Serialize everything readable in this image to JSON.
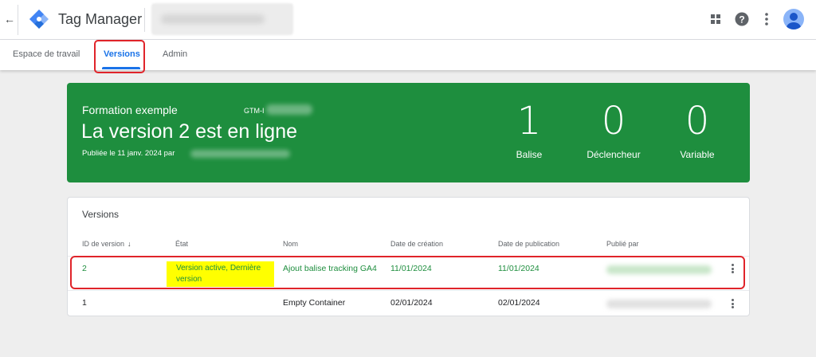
{
  "header": {
    "app_title": "Tag Manager",
    "back_icon": "arrow-back-icon",
    "logo_icon": "tag-manager-logo-icon",
    "apps_icon": "apps-grid-icon",
    "help_icon": "help-icon",
    "more_icon": "more-vert-icon",
    "avatar_icon": "account-avatar-icon"
  },
  "tabs": [
    {
      "label": "Espace de travail",
      "active": false
    },
    {
      "label": "Versions",
      "active": true
    },
    {
      "label": "Admin",
      "active": false
    }
  ],
  "banner": {
    "container_name": "Formation exemple",
    "container_id": "GTM-I",
    "headline": "La version 2 est en ligne",
    "published": "Publiée le 11 janv. 2024 par",
    "stats": [
      {
        "value": "1",
        "label": "Balise"
      },
      {
        "value": "0",
        "label": "Déclencheur"
      },
      {
        "value": "0",
        "label": "Variable"
      }
    ],
    "color": "#1e8e3e"
  },
  "versions_table": {
    "title": "Versions",
    "columns": [
      "ID de version",
      "État",
      "Nom",
      "Date de création",
      "Date de publication",
      "Publié par"
    ],
    "sort_icon": "arrow-down-icon",
    "rows": [
      {
        "id": "2",
        "state": "Version active, Dernière version",
        "name": "Ajout balise tracking GA4",
        "created": "11/01/2024",
        "published": "11/01/2024"
      },
      {
        "id": "1",
        "state": "",
        "name": "Empty Container",
        "created": "02/01/2024",
        "published": "02/01/2024"
      }
    ]
  },
  "colors": {
    "accent": "#1a73e8",
    "live_green": "#1e8e3e",
    "highlight_yellow": "#ffff00",
    "annotation_red": "#e0242a"
  }
}
